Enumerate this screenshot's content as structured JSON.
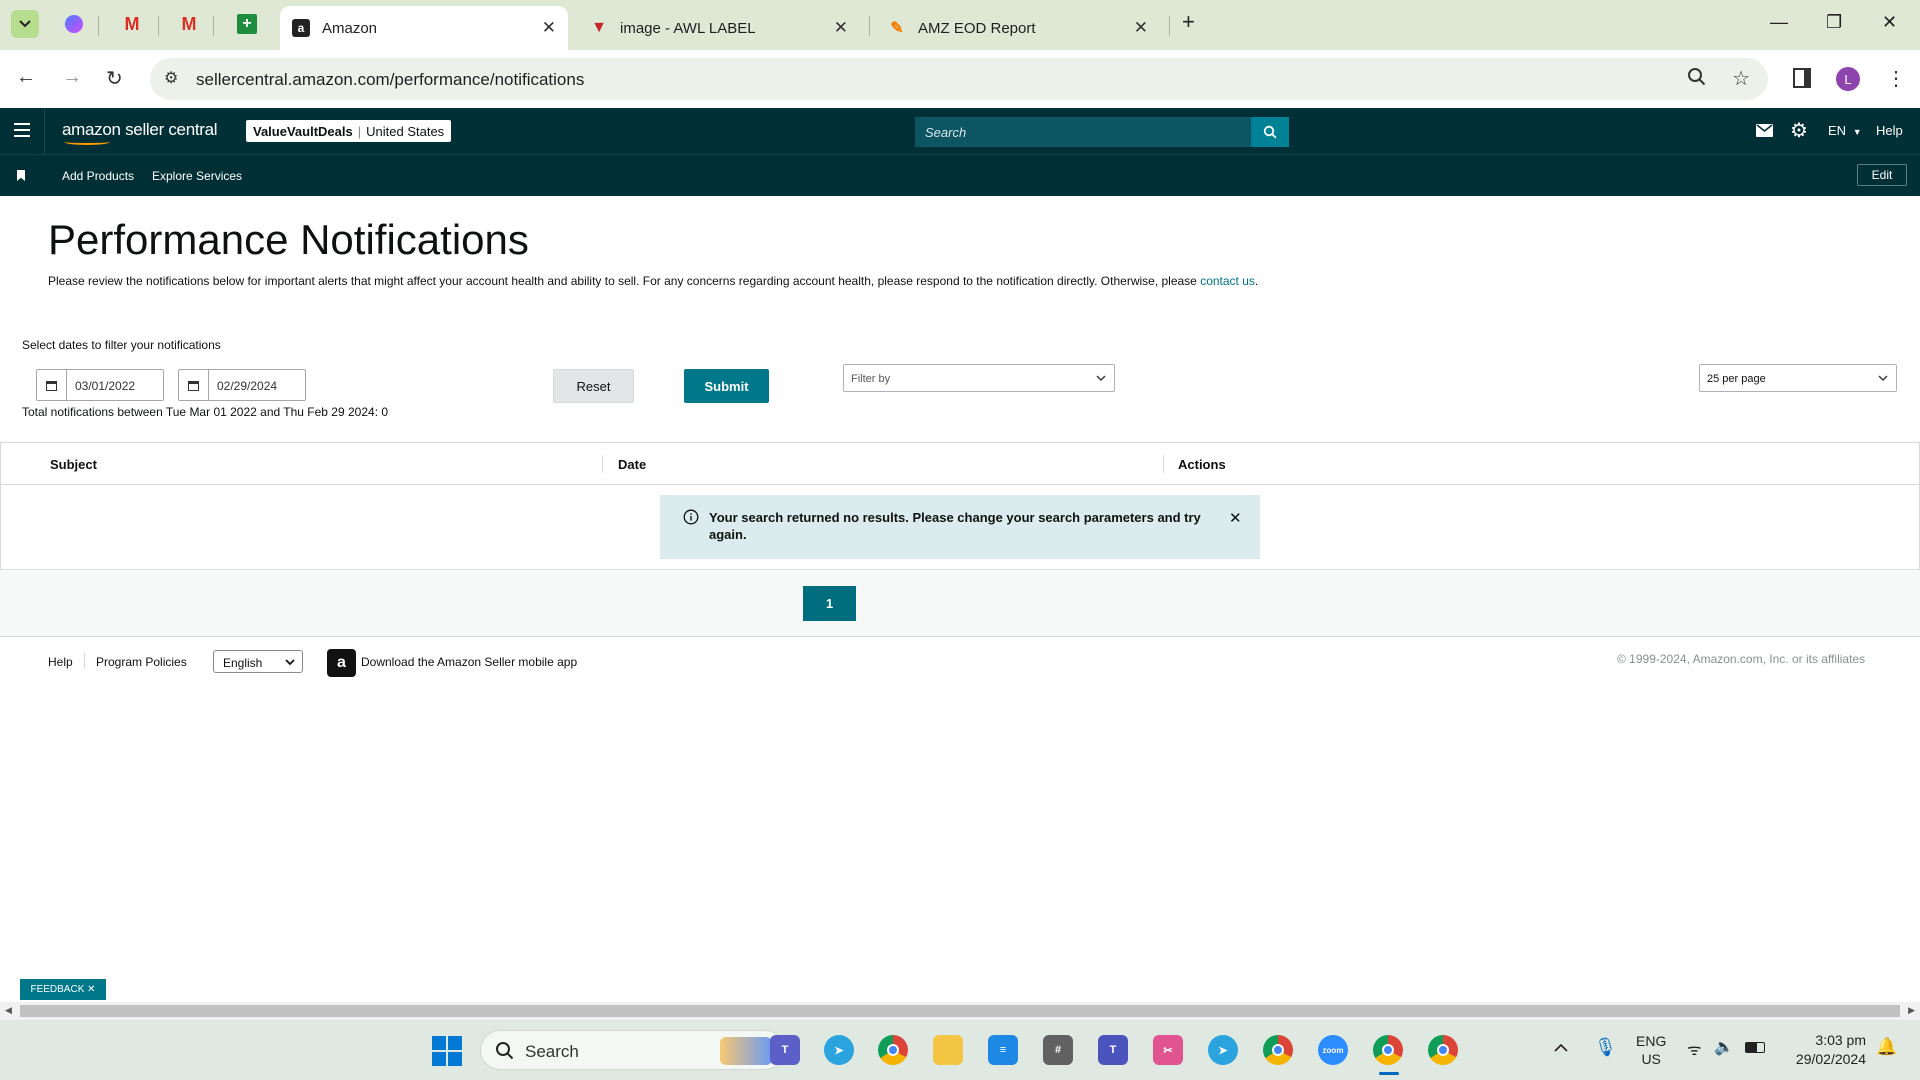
{
  "browser": {
    "tabs": [
      {
        "title": "Amazon",
        "active": true,
        "icon": "amazon-icon"
      },
      {
        "title": "image - AWL LABEL",
        "active": false,
        "icon": "awl-icon"
      },
      {
        "title": "AMZ EOD Report",
        "active": false,
        "icon": "pencil-icon"
      }
    ],
    "url": "sellercentral.amazon.com/performance/notifications",
    "profile_initial": "L"
  },
  "header": {
    "logo_text": "amazon seller central",
    "store_name": "ValueVaultDeals",
    "marketplace": "United States",
    "search_placeholder": "Search",
    "language": "EN",
    "help": "Help"
  },
  "nav": {
    "items": [
      "Add Products",
      "Explore Services"
    ],
    "edit_label": "Edit"
  },
  "page": {
    "title": "Performance Notifications",
    "description": "Please review the notifications below for important alerts that might affect your account health and ability to sell. For any concerns regarding account health, please respond to the notification directly. Otherwise, please",
    "contact_link": "contact us",
    "contact_suffix": ".",
    "filter_label": "Select dates to filter your notifications",
    "start_date": "03/01/2022",
    "end_date": "02/29/2024",
    "reset_label": "Reset",
    "submit_label": "Submit",
    "filter_by": "Filter by",
    "per_page": "25 per page",
    "total_text": "Total notifications between Tue Mar 01 2022 and Thu Feb 29 2024: 0"
  },
  "table": {
    "columns": [
      "Subject",
      "Date",
      "Actions"
    ],
    "empty_message": "Your search returned no results. Please change your search parameters and try again."
  },
  "pagination": {
    "current_page": "1"
  },
  "footer": {
    "help": "Help",
    "policies": "Program Policies",
    "language": "English",
    "app_text": "Download the Amazon Seller mobile app",
    "copyright": "© 1999-2024, Amazon.com, Inc. or its affiliates"
  },
  "feedback_label": "FEEDBACK ✕",
  "taskbar": {
    "search": "Search",
    "lang_top": "ENG",
    "lang_bottom": "US",
    "time": "3:03 pm",
    "date": "29/02/2024"
  },
  "colors": {
    "header_bg": "#002f36",
    "accent": "#008296",
    "submit_bg": "#00788a",
    "alert_bg": "#dcecee"
  }
}
